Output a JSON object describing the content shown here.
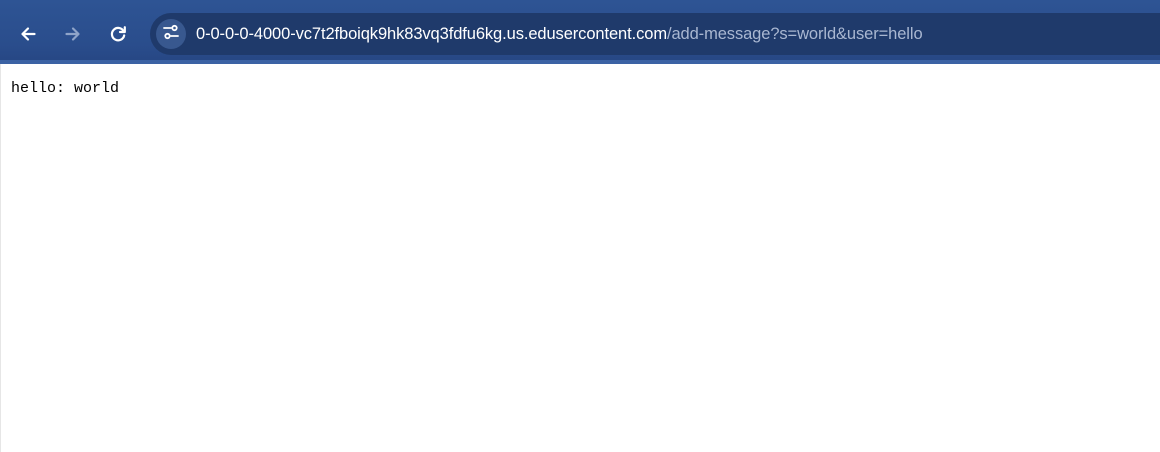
{
  "toolbar": {
    "back_icon": "arrow-left-icon",
    "forward_icon": "arrow-right-icon",
    "reload_icon": "reload-icon",
    "site_info_icon": "tune-icon",
    "colors": {
      "toolbar_bg": "#2a4d8c",
      "omnibox_bg": "#1f3a6b",
      "url_host": "#ffffff",
      "url_path": "#a9b7d1"
    }
  },
  "address_bar": {
    "host": "0-0-0-0-4000-vc7t2fboiqk9hk83vq3fdfu6kg.us.edusercontent.com",
    "path": "/add-message?s=world&user=hello"
  },
  "page": {
    "message": "hello: world"
  }
}
